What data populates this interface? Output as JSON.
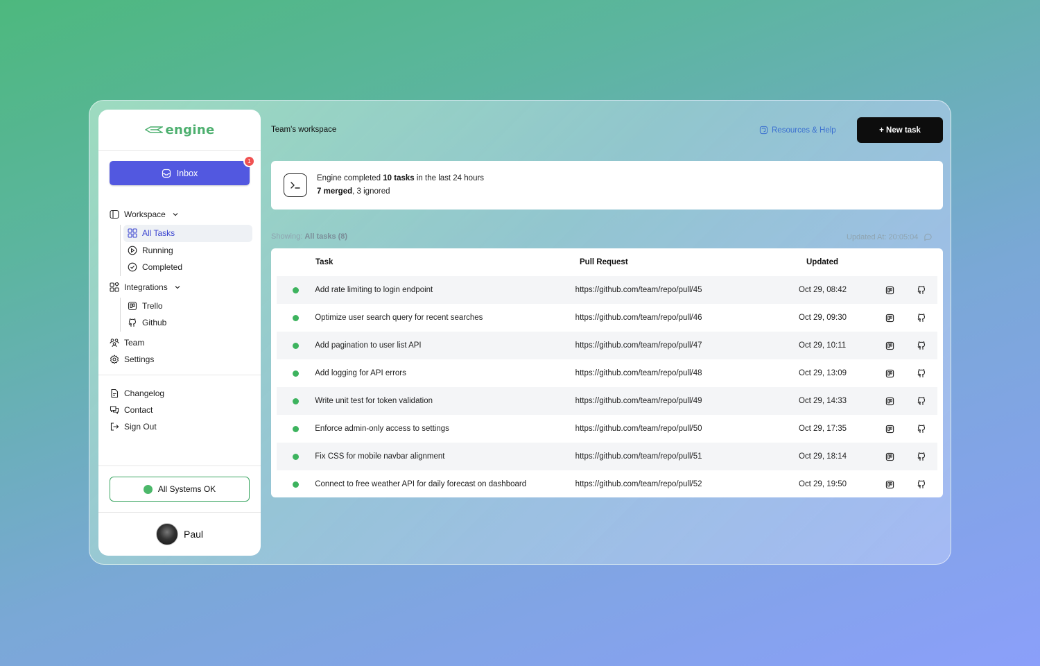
{
  "sidebar": {
    "logo": "engine",
    "inbox": {
      "label": "Inbox",
      "badge": "1"
    },
    "workspace": {
      "label": "Workspace",
      "items": [
        {
          "label": "All Tasks",
          "icon": "grid-icon"
        },
        {
          "label": "Running",
          "icon": "play-circle-icon"
        },
        {
          "label": "Completed",
          "icon": "check-circle-icon"
        }
      ]
    },
    "integrations": {
      "label": "Integrations",
      "items": [
        {
          "label": "Trello",
          "icon": "trello-icon"
        },
        {
          "label": "Github",
          "icon": "github-icon"
        }
      ]
    },
    "team": "Team",
    "settings": "Settings",
    "footer": {
      "changelog": "Changelog",
      "contact": "Contact",
      "signout": "Sign Out"
    },
    "status": "All Systems OK",
    "user": "Paul"
  },
  "header": {
    "title": "Team's workspace",
    "help": "Resources & Help",
    "new_task": "+ New task"
  },
  "summary": {
    "line1_pre": "Engine completed ",
    "line1_bold": "10 tasks",
    "line1_post": " in the last 24 hours",
    "line2_bold": "7 merged",
    "line2_post": ", 3 ignored"
  },
  "list": {
    "showing_label": "Showing:",
    "showing_value": "All tasks (8)",
    "updated_at": "Updated At: 20:05:04"
  },
  "table": {
    "headers": {
      "task": "Task",
      "pr": "Pull Request",
      "updated": "Updated"
    },
    "rows": [
      {
        "task": "Add rate limiting to login endpoint",
        "pr": "https://github.com/team/repo/pull/45",
        "updated": "Oct 29, 08:42"
      },
      {
        "task": "Optimize user search query for recent searches",
        "pr": "https://github.com/team/repo/pull/46",
        "updated": "Oct 29, 09:30"
      },
      {
        "task": "Add pagination to user list API",
        "pr": "https://github.com/team/repo/pull/47",
        "updated": "Oct 29, 10:11"
      },
      {
        "task": "Add logging for API errors",
        "pr": "https://github.com/team/repo/pull/48",
        "updated": "Oct 29, 13:09"
      },
      {
        "task": "Write unit test for token validation",
        "pr": "https://github.com/team/repo/pull/49",
        "updated": "Oct 29, 14:33"
      },
      {
        "task": "Enforce admin-only access to settings",
        "pr": "https://github.com/team/repo/pull/50",
        "updated": "Oct 29, 17:35"
      },
      {
        "task": "Fix CSS for mobile navbar alignment",
        "pr": "https://github.com/team/repo/pull/51",
        "updated": "Oct 29, 18:14"
      },
      {
        "task": "Connect to free weather API for daily forecast on dashboard",
        "pr": "https://github.com/team/repo/pull/52",
        "updated": "Oct 29, 19:50"
      }
    ]
  },
  "colors": {
    "accent": "#5258e0",
    "brand": "#4caf6e",
    "status": "#3db35e",
    "link": "#3a6fd0"
  }
}
